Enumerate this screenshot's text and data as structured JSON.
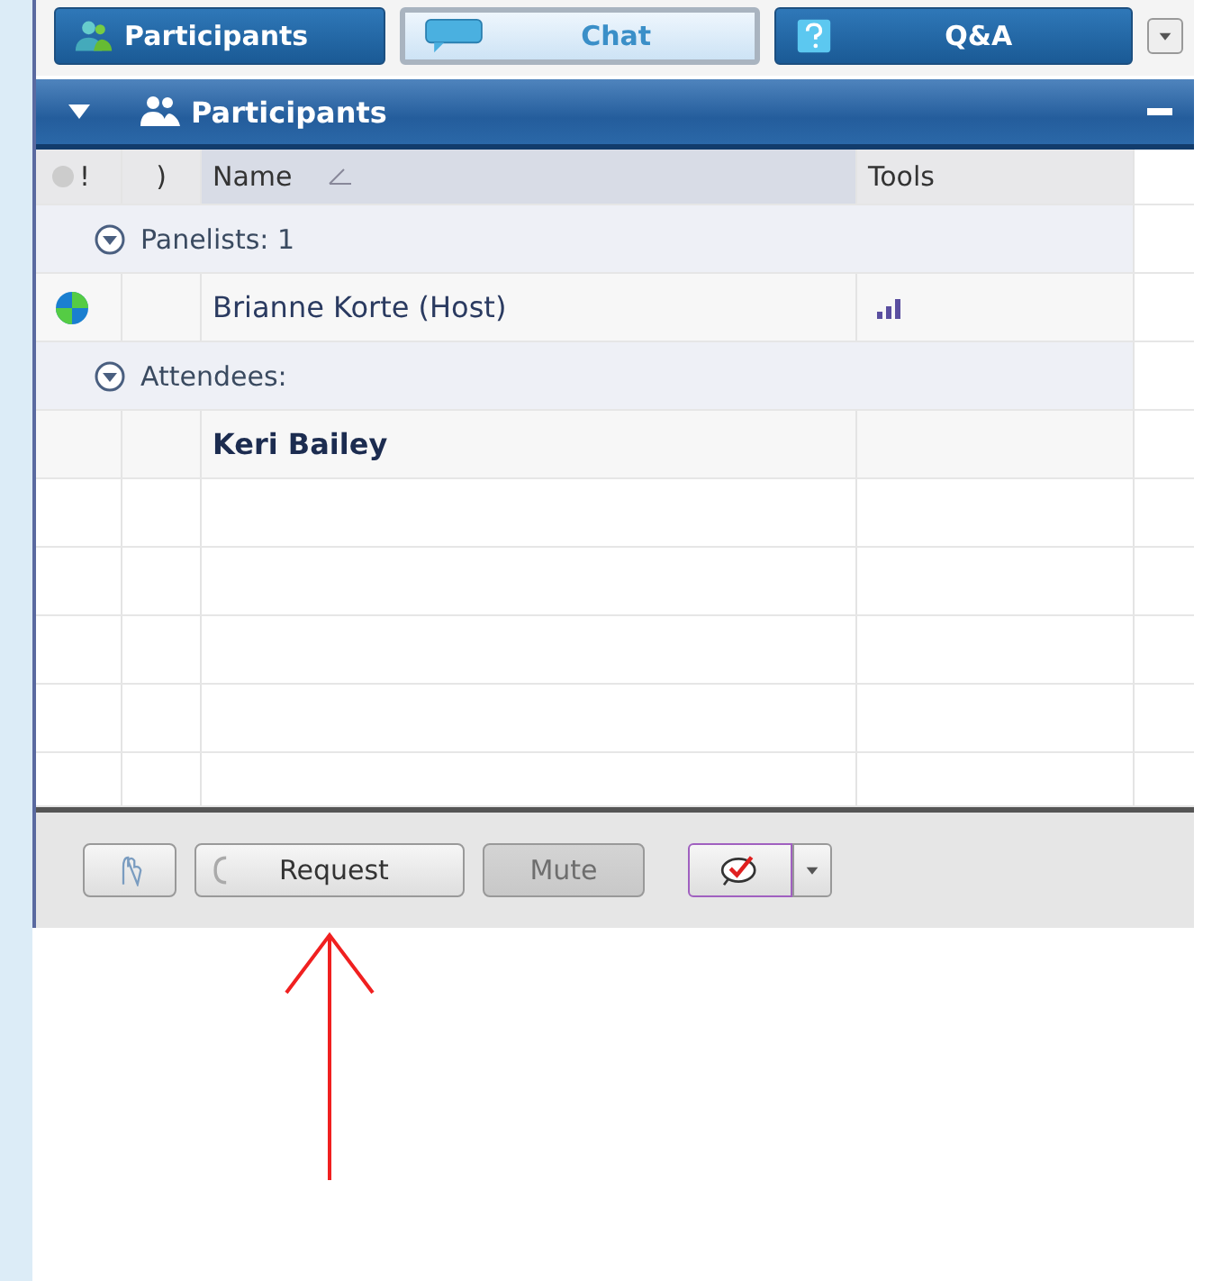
{
  "tabs": [
    {
      "label": "Participants",
      "selected": false
    },
    {
      "label": "Chat",
      "selected": true
    },
    {
      "label": "Q&A",
      "selected": false
    }
  ],
  "panel": {
    "title": "Participants",
    "expanded": true
  },
  "table": {
    "columns": [
      {
        "label": "!"
      },
      {
        "label": ")"
      },
      {
        "label": "Name"
      },
      {
        "label": "Tools"
      }
    ],
    "rows": [
      {
        "kind": "group",
        "label": "Panelists: 1",
        "expanded": true
      },
      {
        "kind": "person",
        "name": "Brianne Korte (Host)",
        "online": true,
        "audio": true,
        "current_user": false
      },
      {
        "kind": "group",
        "label": "Attendees:",
        "expanded": true
      },
      {
        "kind": "person",
        "name": "Keri Bailey",
        "online": false,
        "audio": false,
        "current_user": true
      }
    ]
  },
  "toolbar": {
    "buttons": [
      {
        "kind": "raise-hand"
      },
      {
        "kind": "request",
        "label": "Request",
        "disabled": false
      },
      {
        "kind": "mute",
        "label": "Mute",
        "disabled": true
      },
      {
        "kind": "feedback"
      }
    ]
  }
}
